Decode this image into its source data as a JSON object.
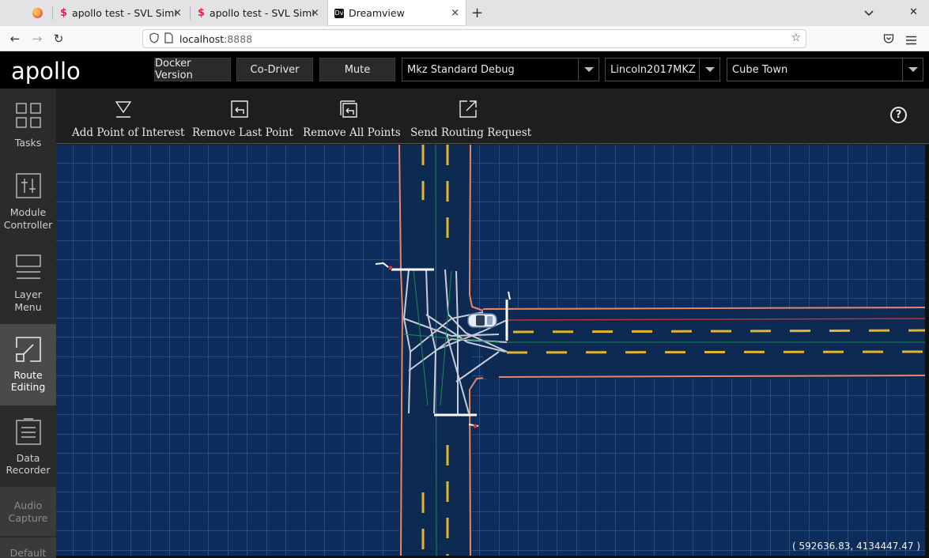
{
  "browser": {
    "tabs": [
      {
        "label": "apollo test - SVL Simulator",
        "icon": "svl-icon",
        "close": "×"
      },
      {
        "label": "apollo test - SVL Simulator",
        "icon": "svl-icon",
        "close": "×"
      },
      {
        "label": "Dreamview",
        "icon": "dreamview-icon",
        "close": "×",
        "active": true
      }
    ],
    "new_tab": "+",
    "window_close": "✕",
    "url_host": "localhost",
    "url_port": ":8888"
  },
  "header": {
    "logo": "apollo",
    "buttons": [
      {
        "label": "Docker Version"
      },
      {
        "label": "Co-Driver"
      },
      {
        "label": "Mute"
      }
    ],
    "selects": [
      {
        "value": "Mkz Standard Debug"
      },
      {
        "value": "Lincoln2017MKZ"
      },
      {
        "value": "Cube Town"
      }
    ]
  },
  "sidebar": {
    "items": [
      {
        "line1": "Tasks",
        "line2": ""
      },
      {
        "line1": "Module",
        "line2": "Controller"
      },
      {
        "line1": "Layer",
        "line2": "Menu"
      },
      {
        "line1": "Route",
        "line2": "Editing",
        "active": true
      },
      {
        "line1": "Data",
        "line2": "Recorder"
      },
      {
        "line1": "Audio",
        "line2": "Capture",
        "disabled": true
      },
      {
        "line1": "Default",
        "line2": "",
        "disabled": true
      }
    ]
  },
  "toolbar": {
    "tools": [
      {
        "label": "Add Point of Interest",
        "icon": "add-poi-icon"
      },
      {
        "label": "Remove Last Point",
        "icon": "remove-last-icon"
      },
      {
        "label": "Remove All Points",
        "icon": "remove-all-icon"
      },
      {
        "label": "Send Routing Request",
        "icon": "send-icon"
      }
    ],
    "help": "?"
  },
  "map": {
    "coordinates": "( 592636.83, 4134447.47 )",
    "colors": {
      "background": "#0c2d5b",
      "grid": "#3f5f8c",
      "lane_boundary": "#e8866a",
      "center_dash": "#e3b530",
      "stop_line": "#ffffff",
      "junction_path": "#c8ccd4"
    }
  }
}
